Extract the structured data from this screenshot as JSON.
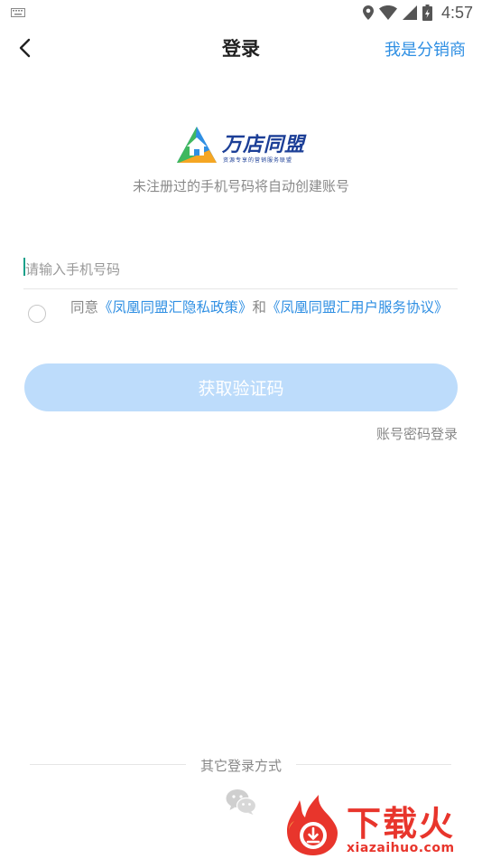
{
  "status_bar": {
    "time": "4:57",
    "icons": [
      "keyboard-icon",
      "location-icon",
      "wifi-icon",
      "signal-icon",
      "battery-icon"
    ]
  },
  "nav": {
    "back_icon": "chevron-left-icon",
    "title": "登录",
    "right_link": "我是分销商"
  },
  "logo": {
    "name": "万店同盟",
    "slogan": "资源专享的营销服务联盟"
  },
  "subtitle": "未注册过的手机号码将自动创建账号",
  "phone_input": {
    "value": "",
    "placeholder": "请输入手机号码"
  },
  "agreement": {
    "checked": false,
    "prefix": "同意",
    "privacy_link": "《凤凰同盟汇隐私政策》",
    "conjunction": "和",
    "service_link": "《凤凰同盟汇用户服务协议》"
  },
  "get_code_button": "获取验证码",
  "password_login_link": "账号密码登录",
  "other_login": {
    "label": "其它登录方式",
    "wechat_icon": "wechat-icon"
  },
  "watermark": {
    "name": "下载火",
    "domain": "xiazaihuo.com"
  },
  "colors": {
    "accent": "#2f8fe3",
    "button_disabled": "#bddcfb",
    "logo_blue": "#1c3f97",
    "watermark_red": "#e8352c"
  }
}
